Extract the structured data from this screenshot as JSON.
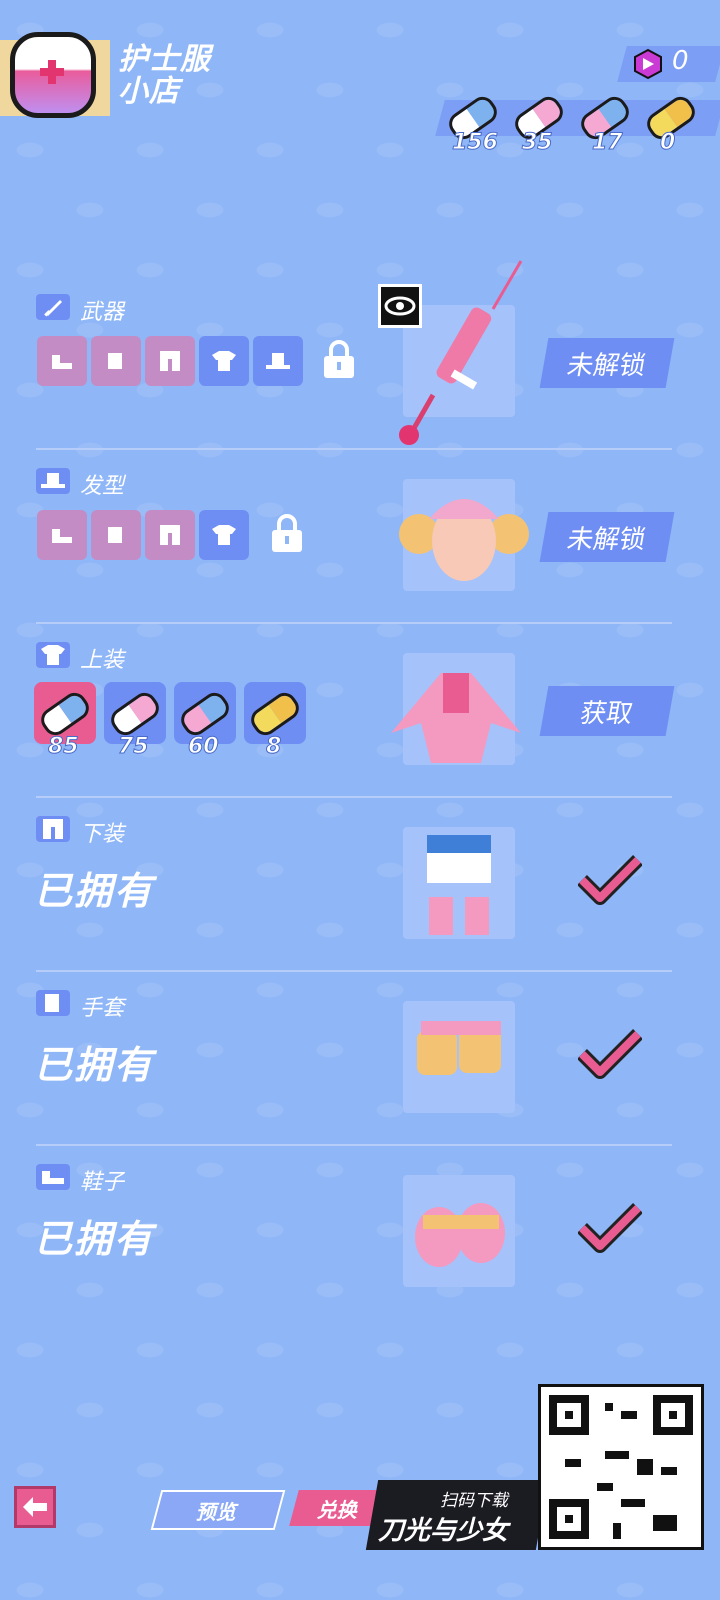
{
  "header": {
    "title_line1": "护士服",
    "title_line2": "小店",
    "gem_count": "0",
    "currencies": [
      {
        "icon": "pill-white-blue-icon",
        "value": "156"
      },
      {
        "icon": "pill-white-pink-icon",
        "value": "35"
      },
      {
        "icon": "pill-pink-blue-icon",
        "value": "17"
      },
      {
        "icon": "pill-gold-icon",
        "value": "0"
      }
    ]
  },
  "sections": {
    "weapon": {
      "label": "武器",
      "status": "未解锁"
    },
    "hair": {
      "label": "发型",
      "status": "未解锁"
    },
    "top": {
      "label": "上装",
      "status": "获取",
      "prices": [
        "85",
        "75",
        "60",
        "8"
      ]
    },
    "bottom": {
      "label": "下装",
      "owned": "已拥有"
    },
    "gloves": {
      "label": "手套",
      "owned": "已拥有"
    },
    "shoes": {
      "label": "鞋子",
      "owned": "已拥有"
    }
  },
  "footer": {
    "preview_label": "预览",
    "exchange_label": "兑换",
    "banner_top": "扫码下载",
    "banner_main": "刀光与少女"
  },
  "colors": {
    "background": "#8fb6f7",
    "accent_pink": "#e85c91",
    "accent_blue": "#6f8ef4"
  }
}
